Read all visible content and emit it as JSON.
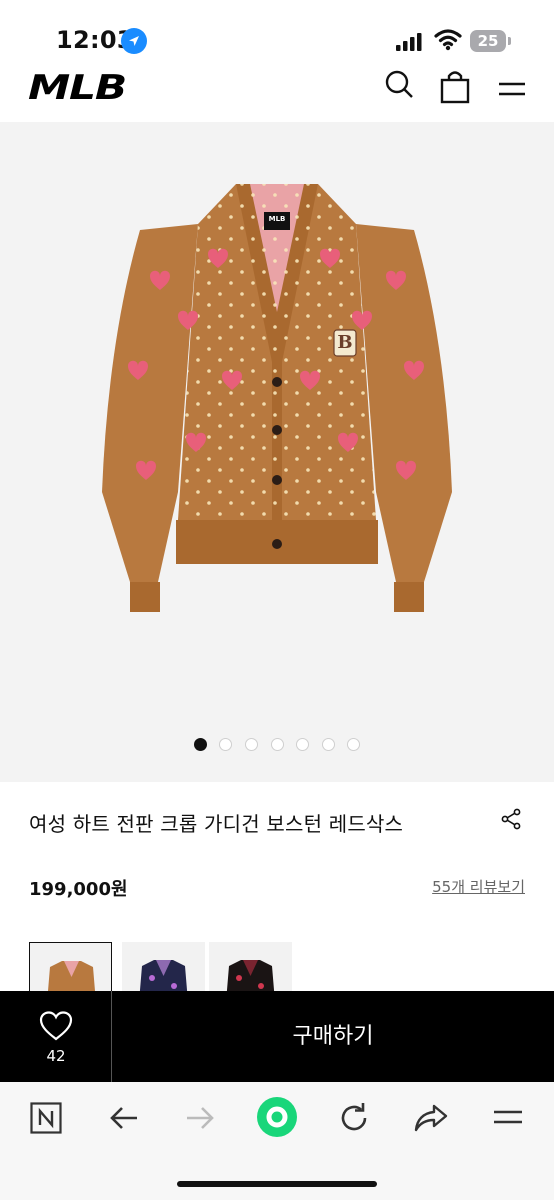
{
  "status_bar": {
    "time": "12:03",
    "battery": "25"
  },
  "header": {
    "logo": "MLB"
  },
  "gallery": {
    "image_count": 7,
    "active_index": 0,
    "garment_label": "MLB",
    "emblem": "B"
  },
  "product": {
    "title": "여성 하트 전판 크롭 가디건 보스턴 레드삭스",
    "price": "199,000원",
    "review_link": "55개 리뷰보기"
  },
  "colors": {
    "brand_black": "#000000",
    "product_brown": "#b8793f",
    "heart_pink": "#e85f7a"
  },
  "buy_bar": {
    "wish_count": "42",
    "buy_label": "구매하기"
  },
  "browser": {
    "accent": "#19d67a"
  }
}
